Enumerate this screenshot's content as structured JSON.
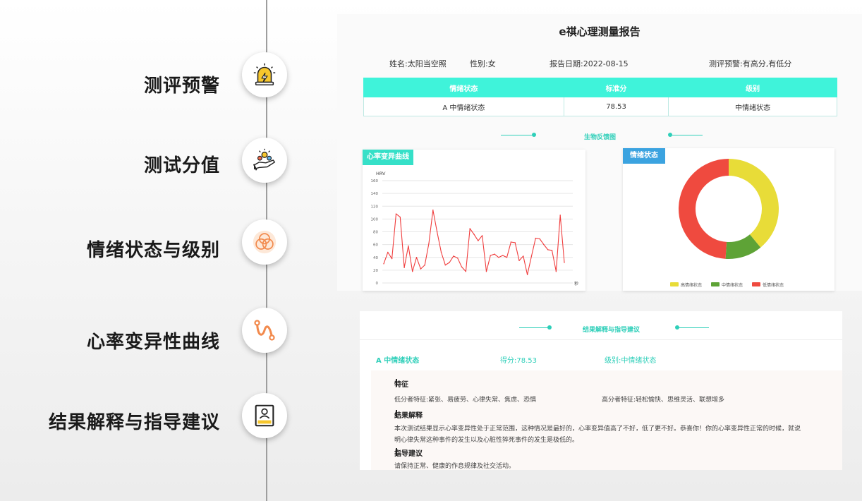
{
  "steps": [
    {
      "label": "测评预警",
      "icon": "warning-light-icon"
    },
    {
      "label": "测试分值",
      "icon": "hand-score-icon"
    },
    {
      "label": "情绪状态与级别",
      "icon": "overlapping-circles-icon"
    },
    {
      "label": "心率变异性曲线",
      "icon": "curve-icon"
    },
    {
      "label": "结果解释与指导建议",
      "icon": "document-icon"
    }
  ],
  "report": {
    "title": "e祺心理测量报告",
    "name": "姓名:太阳当空照",
    "gender": "性别:女",
    "date": "报告日期:2022-08-15",
    "warning": "测评预警:有高分,有低分",
    "table": {
      "headers": [
        "情绪状态",
        "标准分",
        "级别"
      ],
      "row": [
        "A 中情绪状态",
        "78.53",
        "中情绪状态"
      ]
    },
    "bio_section": "生物反馈图"
  },
  "hrv_chart": {
    "tag": "心率变异曲线"
  },
  "emotion_chart": {
    "tag": "情绪状态"
  },
  "chart_data": [
    {
      "type": "line",
      "title": "心率变异曲线",
      "ylabel": "HRV",
      "xlabel": "秒",
      "ylim": [
        0,
        160
      ],
      "yticks": [
        "0",
        "20",
        "40",
        "60",
        "80",
        "100",
        "120",
        "140",
        "160"
      ],
      "grid": true,
      "color": "#f03c3c",
      "values": [
        30,
        48,
        38,
        108,
        103,
        24,
        58,
        18,
        40,
        22,
        28,
        62,
        114,
        80,
        48,
        28,
        32,
        42,
        39,
        25,
        18,
        85,
        76,
        66,
        74,
        18,
        43,
        45,
        40,
        43,
        40,
        64,
        63,
        35,
        42,
        13,
        42,
        70,
        69,
        60,
        52,
        51,
        18,
        106,
        32
      ]
    },
    {
      "type": "pie",
      "title": "情绪状态",
      "donut": true,
      "legend": "bottom",
      "categories": [
        "高情绪状态",
        "中情绪状态",
        "低情绪状态"
      ],
      "values": [
        39,
        12,
        49
      ],
      "colors": [
        "#e8dc38",
        "#5ea336",
        "#ef4a3f"
      ]
    }
  ],
  "result": {
    "section_title": "结果解释与指导建议",
    "summary_state": "A 中情绪状态",
    "summary_score": "得分:78.53",
    "summary_level": "级别:中情绪状态",
    "feature_title": "特征",
    "low_feature": "低分者特征:紧张、易疲劳、心律失常、焦虑、恐惧",
    "high_feature": "高分者特征:轻松愉快、思维灵活、联想增多",
    "explain_title": "结果解释",
    "explain_line1": "本次测试结果显示心率变异性处于正常范围，这种情况是最好的，心率变异值高了不好，低了更不好。恭喜你！你的心率变异性正常的时候，就说",
    "explain_line2": "明心律失常这种事件的发生以及心脏性猝死事件的发生是极低的。",
    "advice_title": "指导建议",
    "advice_text": "请保持正常、健康的作息规律及社交活动。"
  }
}
